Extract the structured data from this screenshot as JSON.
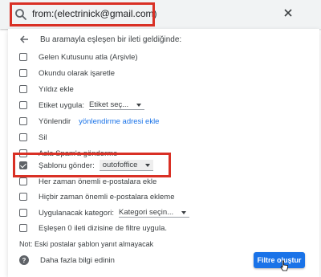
{
  "search": {
    "value": "from:(electrinick@gmail.com)"
  },
  "dialog": {
    "back_text": "Bu aramayla eşleşen bir ileti geldiğinde:",
    "options": [
      {
        "label": "Gelen Kutusunu atla (Arşivle)",
        "checked": false
      },
      {
        "label": "Okundu olarak işaretle",
        "checked": false
      },
      {
        "label": "Yıldız ekle",
        "checked": false
      },
      {
        "label": "Etiket uygula:",
        "checked": false,
        "dropdown": "Etiket seç..."
      },
      {
        "label": "Yönlendir",
        "checked": false,
        "link": "yönlendirme adresi ekle"
      },
      {
        "label": "Sil",
        "checked": false
      },
      {
        "label": "Asla Spam'a gönderme",
        "checked": false
      },
      {
        "label": "Şablonu gönder:",
        "checked": true,
        "dropdown": "outofoffice"
      },
      {
        "label": "Her zaman önemli e-postalara ekle",
        "checked": false
      },
      {
        "label": "Hiçbir zaman önemli e-postalara ekleme",
        "checked": false
      },
      {
        "label": "Uygulanacak kategori:",
        "checked": false,
        "dropdown": "Kategori seçin..."
      },
      {
        "label": "Eşleşen 0 ileti dizisine de filtre uygula.",
        "checked": false
      }
    ],
    "note": "Not: Eski postalar şablon yanıt almayacak",
    "help": "Daha fazla bilgi edinin",
    "create_button": "Filtre oluştur"
  },
  "colors": {
    "accent": "#1a73e8",
    "highlight": "#d93025",
    "search_bg": "#f1f3f4"
  }
}
